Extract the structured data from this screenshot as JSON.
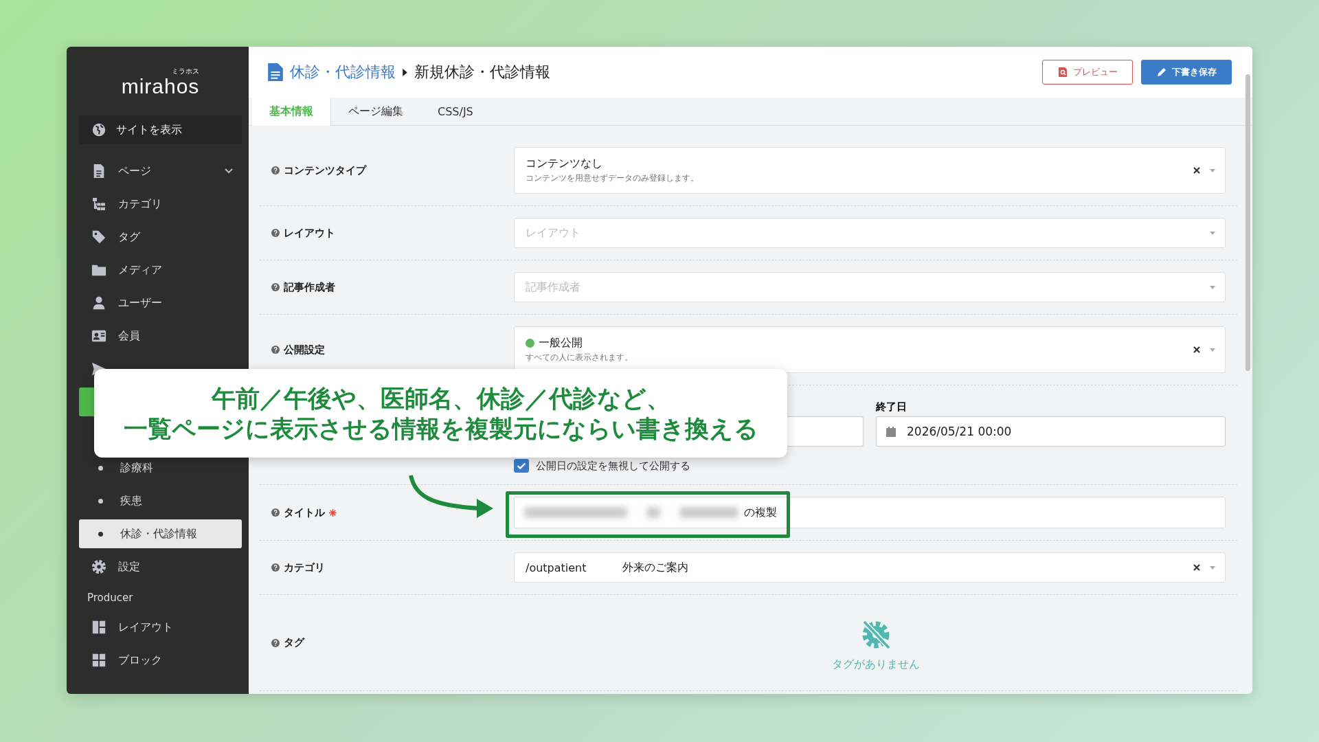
{
  "brand": {
    "logo": "mirahos",
    "ruby": "ミラホス"
  },
  "sidebar": {
    "view_site": "サイトを表示",
    "items": [
      {
        "kind": "item",
        "label": "ページ",
        "expanded": true,
        "selected": false
      },
      {
        "kind": "item",
        "label": "カテゴリ",
        "selected": false
      },
      {
        "kind": "item",
        "label": "タグ",
        "selected": false
      },
      {
        "kind": "item",
        "label": "メディア",
        "selected": false
      },
      {
        "kind": "item",
        "label": "ユーザー",
        "selected": false
      },
      {
        "kind": "item",
        "label": "会員",
        "selected": false
      },
      {
        "kind": "item",
        "selected": false
      },
      {
        "kind": "group",
        "selected": true
      },
      {
        "kind": "sub",
        "label": "診療科",
        "selected": false
      },
      {
        "kind": "sub",
        "label": "疾患",
        "selected": false
      },
      {
        "kind": "sub",
        "label": "休診・代診情報",
        "selected": true
      },
      {
        "kind": "item",
        "label": "設定",
        "selected": false
      },
      {
        "kind": "section",
        "label": "Producer"
      },
      {
        "kind": "item",
        "label": "レイアウト",
        "selected": false
      },
      {
        "kind": "item",
        "label": "ブロック",
        "selected": false
      }
    ]
  },
  "header": {
    "parent": "休診・代診情報",
    "current": "新規休診・代診情報",
    "buttons": [
      {
        "kind": "outline",
        "label": "プレビュー"
      },
      {
        "kind": "primary",
        "label": "下書き保存"
      }
    ]
  },
  "tabs": [
    {
      "label": "基本情報",
      "selected": true
    },
    {
      "label": "ページ編集",
      "selected": false
    },
    {
      "label": "CSS/JS",
      "selected": false
    }
  ],
  "fields": [
    {
      "kind": "select",
      "label": "コンテンツタイプ",
      "value": "コンテンツなし",
      "description": "コンテンツを用意せずデータのみ登録します。",
      "clearable": true
    },
    {
      "kind": "select",
      "label": "レイアウト",
      "placeholder": "レイアウト",
      "clearable": false
    },
    {
      "kind": "select",
      "label": "記事作成者",
      "placeholder": "記事作成者",
      "clearable": false
    },
    {
      "kind": "select",
      "label": "公開設定",
      "value": "一般公開",
      "color": "#5cb85c",
      "description": "すべての人に表示されます。",
      "clearable": true
    },
    {
      "kind": "dates",
      "end_label": "終了日",
      "end_value": "2026/05/21 00:00",
      "checkbox": {
        "label": "公開日の設定を無視して公開する",
        "checked": true
      }
    },
    {
      "kind": "text",
      "label": "タイトル",
      "required": true,
      "value_suffix": "の複製"
    },
    {
      "kind": "select",
      "label": "カテゴリ",
      "value": "/outpatient",
      "value_2": "外来のご案内",
      "clearable": true
    },
    {
      "kind": "tags",
      "label": "タグ",
      "empty_text": "タグがありません"
    }
  ],
  "callout": {
    "lines": [
      "午前／午後や、医師名、休診／代診など、",
      "一覧ページに表示させる情報を複製元にならい書き換える"
    ]
  }
}
